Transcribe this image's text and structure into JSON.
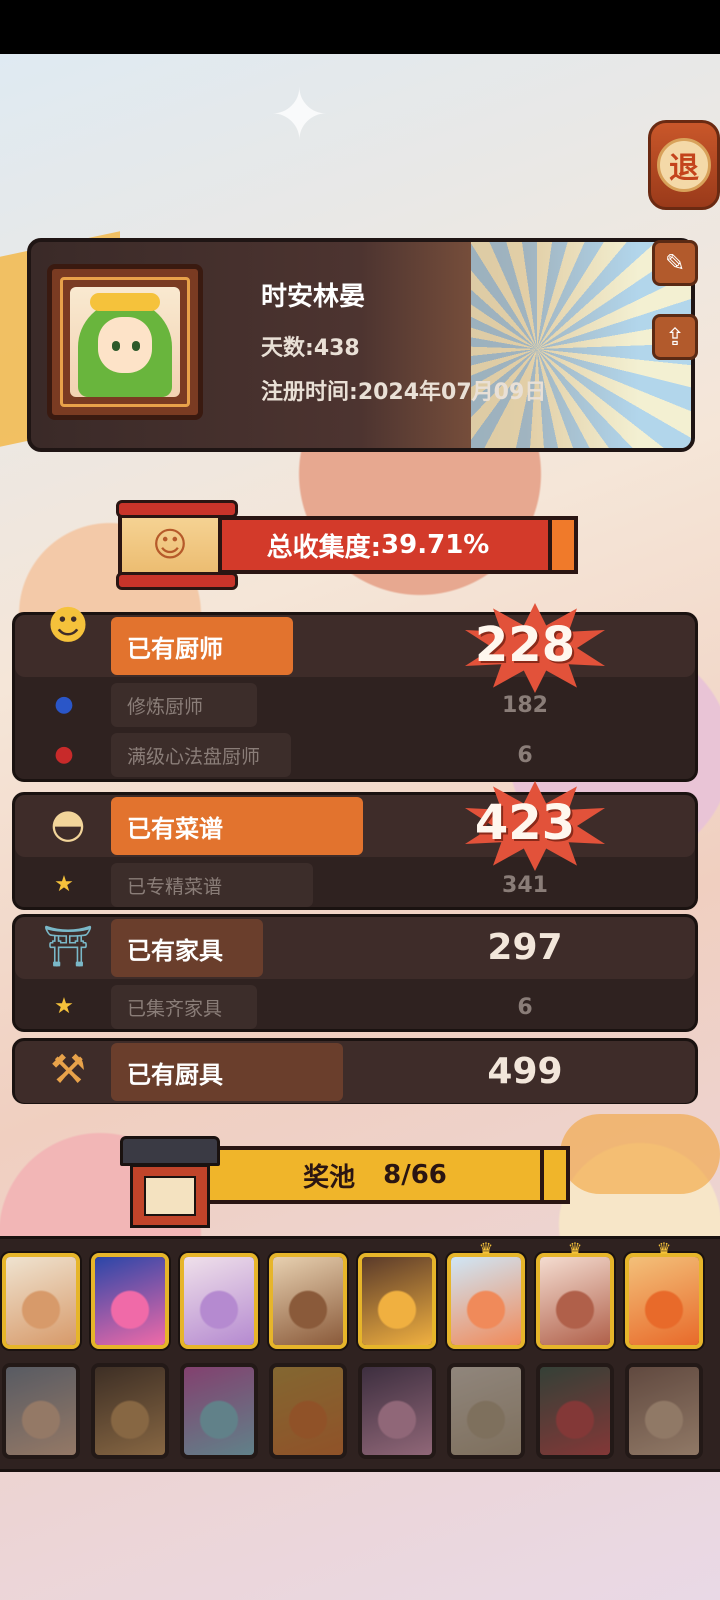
{
  "exit_button": {
    "label": "退"
  },
  "profile": {
    "name": "时安林晏",
    "days_label": "天数:",
    "days_value": "438",
    "register_label": "注册时间:",
    "register_value": "2024年07月09日"
  },
  "total": {
    "label": "总收集度:",
    "value": "39.71%"
  },
  "chefs": {
    "label": "已有厨师",
    "value": "228",
    "sub": [
      {
        "label": "修炼厨师",
        "value": "182"
      },
      {
        "label": "满级心法盘厨师",
        "value": "6"
      }
    ]
  },
  "recipes": {
    "label": "已有菜谱",
    "value": "423",
    "sub": [
      {
        "label": "已专精菜谱",
        "value": "341"
      }
    ]
  },
  "furniture": {
    "label": "已有家具",
    "value": "297",
    "sub": [
      {
        "label": "已集齐家具",
        "value": "6"
      }
    ]
  },
  "utensils": {
    "label": "已有厨具",
    "value": "499"
  },
  "pool": {
    "label": "奖池",
    "value": "8/66"
  },
  "cards_row1": [
    {
      "color": "#efe3d0",
      "accent": "#d79a6a"
    },
    {
      "color": "#2a46a8",
      "accent": "#f06aa8"
    },
    {
      "color": "#efe0ea",
      "accent": "#b58ad0"
    },
    {
      "color": "#e7d0b0",
      "accent": "#8a5a3a"
    },
    {
      "color": "#5a3a2a",
      "accent": "#f0b040"
    },
    {
      "color": "#cfe6f6",
      "accent": "#f08a5a"
    },
    {
      "color": "#f4dcd0",
      "accent": "#b0604a"
    },
    {
      "color": "#f3c07a",
      "accent": "#e86a2a"
    }
  ],
  "cards_row2": [
    {
      "color": "#7a8a9a",
      "accent": "#e8c0a0"
    },
    {
      "color": "#4a3a2a",
      "accent": "#d0a060"
    },
    {
      "color": "#c85ab0",
      "accent": "#8ad0e0"
    },
    {
      "color": "#c8a040",
      "accent": "#e07a30"
    },
    {
      "color": "#4a3a5a",
      "accent": "#e0a0c0"
    },
    {
      "color": "#e0d8c8",
      "accent": "#c0b090"
    },
    {
      "color": "#3a5a4a",
      "accent": "#c84a4a"
    },
    {
      "color": "#8a6a5a",
      "accent": "#e0c0a0"
    }
  ]
}
